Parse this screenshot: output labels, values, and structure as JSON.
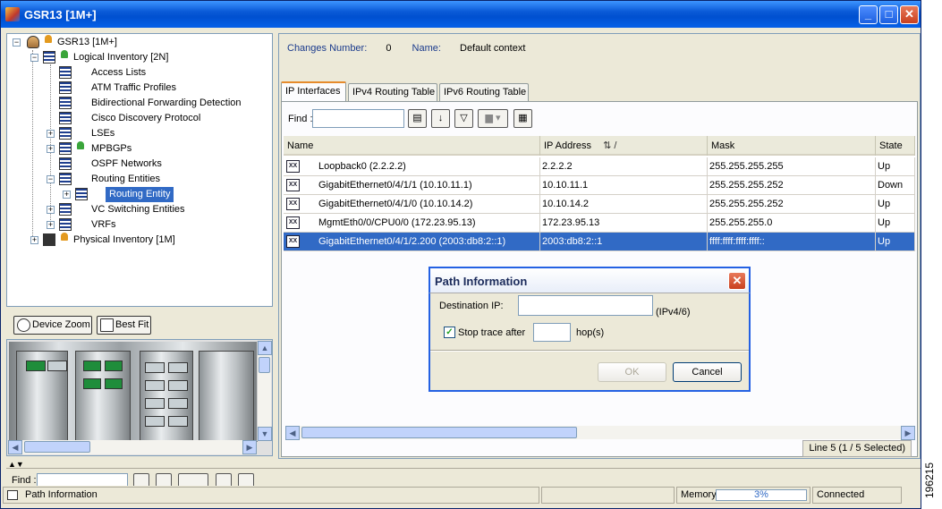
{
  "window": {
    "title": "GSR13 [1M+]"
  },
  "tree": {
    "items": [
      {
        "label": "GSR13 [1M+]"
      },
      {
        "label": "Logical Inventory [2N]"
      },
      {
        "label": "Access Lists"
      },
      {
        "label": "ATM Traffic Profiles"
      },
      {
        "label": "Bidirectional Forwarding Detection"
      },
      {
        "label": "Cisco Discovery Protocol"
      },
      {
        "label": "LSEs"
      },
      {
        "label": "MPBGPs"
      },
      {
        "label": "OSPF Networks"
      },
      {
        "label": "Routing Entities"
      },
      {
        "label": "Routing Entity"
      },
      {
        "label": "VC Switching Entities"
      },
      {
        "label": "VRFs"
      },
      {
        "label": "Physical Inventory [1M]"
      }
    ]
  },
  "zoom": {
    "device_zoom": "Device Zoom",
    "best_fit": "Best Fit"
  },
  "bottom_find": {
    "label": "Find :"
  },
  "details": {
    "changes_label": "Changes Number:",
    "changes_value": "0",
    "name_label": "Name:",
    "name_value": "Default context"
  },
  "tabs": [
    {
      "label": "IP Interfaces"
    },
    {
      "label": "IPv4 Routing Table"
    },
    {
      "label": "IPv6 Routing Table"
    }
  ],
  "find": {
    "label": "Find :",
    "value": ""
  },
  "table": {
    "columns": [
      "Name",
      "IP Address",
      "Mask",
      "State"
    ],
    "sort_indicator": "⇅ /",
    "rows": [
      {
        "name": "Loopback0 (2.2.2.2)",
        "ip": "2.2.2.2",
        "mask": "255.255.255.255",
        "state": "Up"
      },
      {
        "name": "GigabitEthernet0/4/1/1 (10.10.11.1)",
        "ip": "10.10.11.1",
        "mask": "255.255.255.252",
        "state": "Down"
      },
      {
        "name": "GigabitEthernet0/4/1/0 (10.10.14.2)",
        "ip": "10.10.14.2",
        "mask": "255.255.255.252",
        "state": "Up"
      },
      {
        "name": "MgmtEth0/0/CPU0/0 (172.23.95.13)",
        "ip": "172.23.95.13",
        "mask": "255.255.255.0",
        "state": "Up"
      },
      {
        "name": "GigabitEthernet0/4/1/2.200 (2003:db8:2::1)",
        "ip": "2003:db8:2::1",
        "mask": "ffff:ffff:ffff:ffff::",
        "state": "Up"
      }
    ],
    "line_info": "Line 5 (1 / 5 Selected)"
  },
  "dialog": {
    "title": "Path Information",
    "destination_label": "Destination IP:",
    "destination_value": "",
    "destination_hint": "(IPv4/6)",
    "stop_trace_label": "Stop trace after",
    "stop_trace_checked": true,
    "hops_value": "",
    "hops_label": "hop(s)",
    "ok": "OK",
    "cancel": "Cancel"
  },
  "status": {
    "message": "Path Information",
    "memory_label": "Memory:",
    "memory_value": "3%",
    "connection": "Connected"
  },
  "side_label": "196215"
}
